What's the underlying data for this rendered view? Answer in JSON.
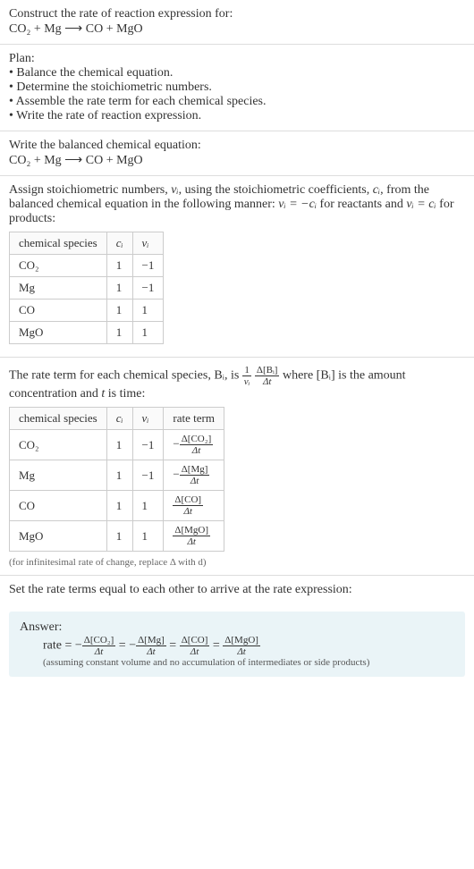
{
  "intro": {
    "line1": "Construct the rate of reaction expression for:",
    "eq": "CO₂ + Mg ⟶ CO + MgO"
  },
  "plan": {
    "head": "Plan:",
    "b1": "• Balance the chemical equation.",
    "b2": "• Determine the stoichiometric numbers.",
    "b3": "• Assemble the rate term for each chemical species.",
    "b4": "• Write the rate of reaction expression."
  },
  "balanced": {
    "head": "Write the balanced chemical equation:",
    "eq": "CO₂ + Mg ⟶ CO + MgO"
  },
  "stoich": {
    "text_a": "Assign stoichiometric numbers, ",
    "nu": "νᵢ",
    "text_b": ", using the stoichiometric coefficients, ",
    "ci": "cᵢ",
    "text_c": ", from the balanced chemical equation in the following manner: ",
    "rel1": "νᵢ = −cᵢ",
    "text_d": " for reactants and ",
    "rel2": "νᵢ = cᵢ",
    "text_e": " for products:",
    "th1": "chemical species",
    "th2": "cᵢ",
    "th3": "νᵢ",
    "rows": [
      {
        "sp": "CO₂",
        "c": "1",
        "v": "−1"
      },
      {
        "sp": "Mg",
        "c": "1",
        "v": "−1"
      },
      {
        "sp": "CO",
        "c": "1",
        "v": "1"
      },
      {
        "sp": "MgO",
        "c": "1",
        "v": "1"
      }
    ]
  },
  "rateterm": {
    "text_a": "The rate term for each chemical species, Bᵢ, is ",
    "frac1_num": "1",
    "frac1_den": "νᵢ",
    "frac2_num": "Δ[Bᵢ]",
    "frac2_den": "Δt",
    "text_b": " where [Bᵢ] is the amount concentration and ",
    "tvar": "t",
    "text_c": " is time:",
    "th1": "chemical species",
    "th2": "cᵢ",
    "th3": "νᵢ",
    "th4": "rate term",
    "rows": [
      {
        "sp": "CO₂",
        "c": "1",
        "v": "−1",
        "neg": "−",
        "num": "Δ[CO₂]",
        "den": "Δt"
      },
      {
        "sp": "Mg",
        "c": "1",
        "v": "−1",
        "neg": "−",
        "num": "Δ[Mg]",
        "den": "Δt"
      },
      {
        "sp": "CO",
        "c": "1",
        "v": "1",
        "neg": "",
        "num": "Δ[CO]",
        "den": "Δt"
      },
      {
        "sp": "MgO",
        "c": "1",
        "v": "1",
        "neg": "",
        "num": "Δ[MgO]",
        "den": "Δt"
      }
    ],
    "note": "(for infinitesimal rate of change, replace Δ with d)"
  },
  "final": {
    "head": "Set the rate terms equal to each other to arrive at the rate expression:"
  },
  "answer": {
    "label": "Answer:",
    "rate_eq_prefix": "rate = ",
    "neg": "−",
    "t1_num": "Δ[CO₂]",
    "t1_den": "Δt",
    "eq": " = ",
    "t2_num": "Δ[Mg]",
    "t2_den": "Δt",
    "t3_num": "Δ[CO]",
    "t3_den": "Δt",
    "t4_num": "Δ[MgO]",
    "t4_den": "Δt",
    "note": "(assuming constant volume and no accumulation of intermediates or side products)"
  },
  "chart_data": {
    "type": "table",
    "tables": [
      {
        "title": "Stoichiometric numbers",
        "columns": [
          "chemical species",
          "c_i",
          "nu_i"
        ],
        "rows": [
          [
            "CO2",
            1,
            -1
          ],
          [
            "Mg",
            1,
            -1
          ],
          [
            "CO",
            1,
            1
          ],
          [
            "MgO",
            1,
            1
          ]
        ]
      },
      {
        "title": "Rate terms",
        "columns": [
          "chemical species",
          "c_i",
          "nu_i",
          "rate term"
        ],
        "rows": [
          [
            "CO2",
            1,
            -1,
            "-Δ[CO2]/Δt"
          ],
          [
            "Mg",
            1,
            -1,
            "-Δ[Mg]/Δt"
          ],
          [
            "CO",
            1,
            1,
            "Δ[CO]/Δt"
          ],
          [
            "MgO",
            1,
            1,
            "Δ[MgO]/Δt"
          ]
        ]
      }
    ]
  }
}
